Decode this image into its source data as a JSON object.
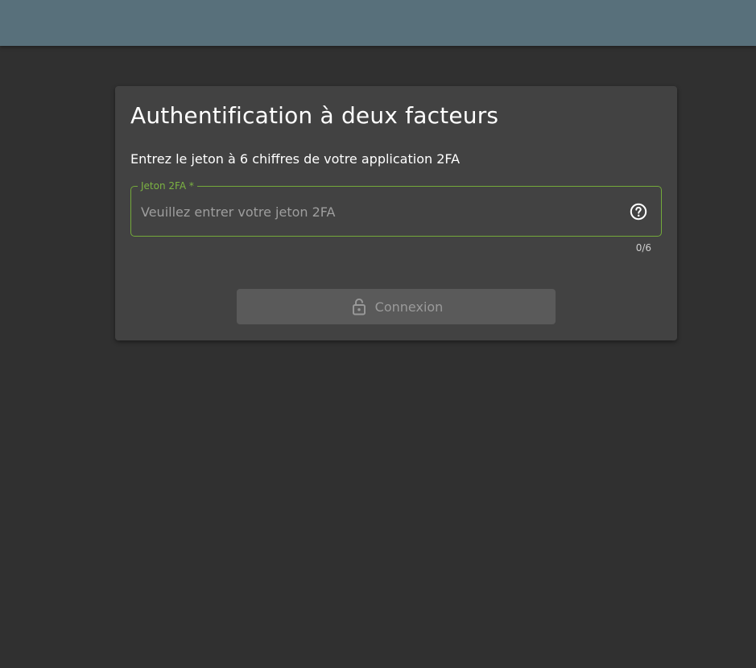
{
  "dialog": {
    "title": "Authentification à deux facteurs",
    "subtitle": "Entrez le jeton à 6 chiffres de votre application 2FA",
    "token_field": {
      "label": "Jeton 2FA *",
      "placeholder": "Veuillez entrer votre jeton 2FA",
      "value": "",
      "counter": "0/6",
      "help_icon": "help-circle-icon"
    },
    "login_button": {
      "label": "Connexion",
      "icon": "lock-open-icon",
      "disabled": true
    }
  },
  "colors": {
    "topbar": "#58707b",
    "background": "#303030",
    "card": "#424242",
    "accent": "#7cb342",
    "button_disabled": "#5a5a5a"
  }
}
